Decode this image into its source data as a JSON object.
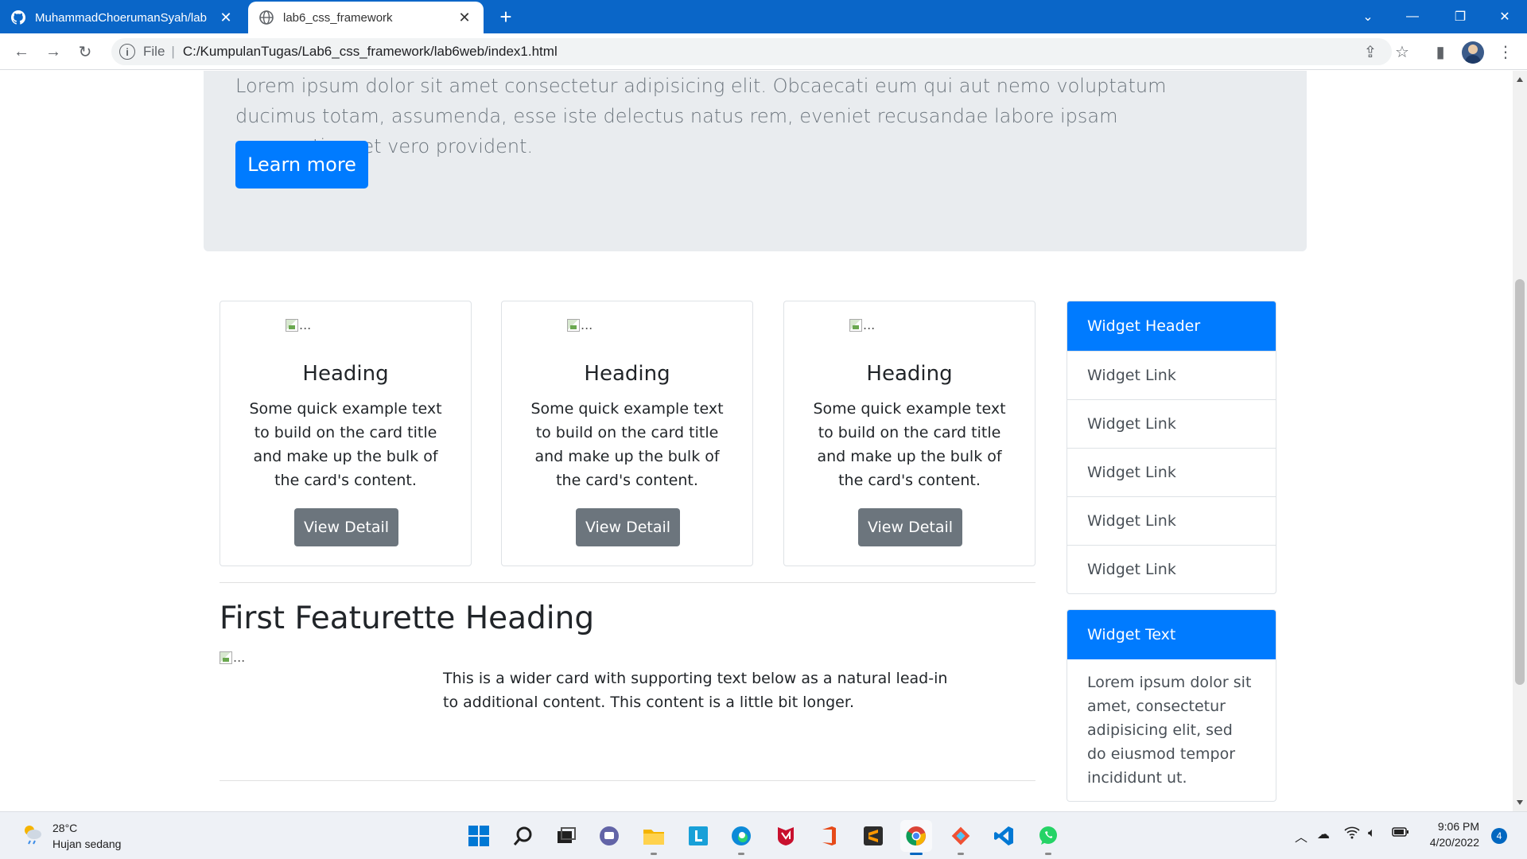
{
  "browser": {
    "tabs": [
      {
        "title": "MuhammadChoerumanSyah/lab",
        "active": false
      },
      {
        "title": "lab6_css_framework",
        "active": true
      }
    ],
    "new_tab_symbol": "+",
    "address": {
      "scheme_label": "File",
      "separator": "|",
      "url": "C:/KumpulanTugas/Lab6_css_framework/lab6web/index1.html"
    }
  },
  "page": {
    "jumbotron": {
      "lead": "Lorem ipsum dolor sit amet consectetur adipisicing elit. Obcaecati eum qui aut nemo voluptatum ducimus totam, assumenda, esse iste delectus natus rem, eveniet recusandae labore ipsam praesentium et vero provident.",
      "button_label": "Learn more",
      "button_color": "#007bff"
    },
    "cards": [
      {
        "img_alt": "...",
        "title": "Heading",
        "text": "Some quick example text to build on the card title and make up the bulk of the card's content.",
        "button_label": "View Detail"
      },
      {
        "img_alt": "...",
        "title": "Heading",
        "text": "Some quick example text to build on the card title and make up the bulk of the card's content.",
        "button_label": "View Detail"
      },
      {
        "img_alt": "...",
        "title": "Heading",
        "text": "Some quick example text to build on the card title and make up the bulk of the card's content.",
        "button_label": "View Detail"
      }
    ],
    "featurette": {
      "heading": "First Featurette Heading",
      "img_alt": "...",
      "text": "This is a wider card with supporting text below as a natural lead-in to additional content. This content is a little bit longer."
    },
    "widget_links": {
      "header": "Widget Header",
      "links": [
        "Widget Link",
        "Widget Link",
        "Widget Link",
        "Widget Link",
        "Widget Link"
      ]
    },
    "widget_text": {
      "header": "Widget Text",
      "body": "Lorem ipsum dolor sit amet, consectetur adipisicing elit, sed do eiusmod tempor incididunt ut."
    }
  },
  "taskbar": {
    "weather": {
      "temp": "28°C",
      "desc": "Hujan sedang"
    },
    "apps": [
      "start",
      "search",
      "task-view",
      "teams-chat",
      "file-explorer",
      "libreoffice",
      "edge",
      "mcafee",
      "office",
      "sublime-text",
      "chrome",
      "git",
      "vscode",
      "whatsapp"
    ],
    "clock": {
      "time": "9:06 PM",
      "date": "4/20/2022"
    },
    "notifications": "4"
  },
  "colors": {
    "titlebar": "#0a66c8",
    "primary": "#007bff",
    "secondary": "#6c757d",
    "jumbotron_bg": "#e9ecef"
  }
}
